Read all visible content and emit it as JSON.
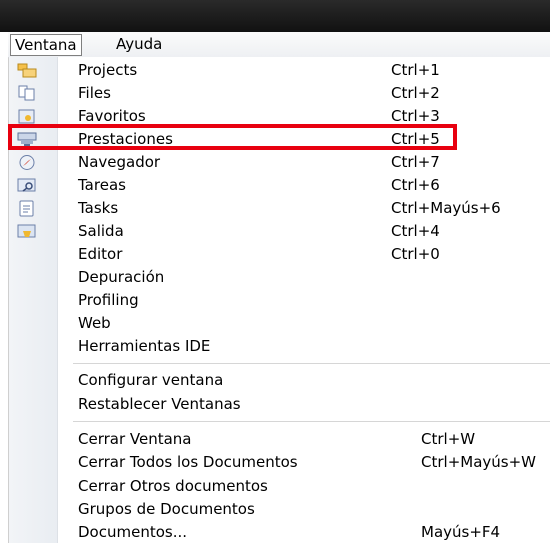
{
  "menubar": {
    "ventana": "Ventana",
    "ayuda": "Ayuda"
  },
  "menu": {
    "items": [
      {
        "label": "Projects",
        "shortcut": "Ctrl+1",
        "icon": "projects-icon"
      },
      {
        "label": "Files",
        "shortcut": "Ctrl+2",
        "icon": "files-icon"
      },
      {
        "label": "Favoritos",
        "shortcut": "Ctrl+3",
        "icon": "favorites-icon"
      },
      {
        "label": "Prestaciones",
        "shortcut": "Ctrl+5",
        "icon": "services-icon"
      },
      {
        "label": "Navegador",
        "shortcut": "Ctrl+7",
        "icon": "navigator-icon"
      },
      {
        "label": "Tareas",
        "shortcut": "Ctrl+6",
        "icon": "tasks-search-icon"
      },
      {
        "label": "Tasks",
        "shortcut": "Ctrl+Mayús+6",
        "icon": "tasks-list-icon"
      },
      {
        "label": "Salida",
        "shortcut": "Ctrl+4",
        "icon": "output-icon"
      },
      {
        "label": "Editor",
        "shortcut": "Ctrl+0"
      },
      {
        "label": "Depuración",
        "shortcut": ""
      },
      {
        "label": "Profiling",
        "shortcut": ""
      },
      {
        "label": "Web",
        "shortcut": ""
      },
      {
        "label": "Herramientas IDE",
        "shortcut": ""
      },
      {
        "label": "Configurar ventana",
        "shortcut": ""
      },
      {
        "label": "Restablecer Ventanas",
        "shortcut": ""
      },
      {
        "label": "Cerrar Ventana",
        "shortcut": "Ctrl+W"
      },
      {
        "label": "Cerrar Todos los Documentos",
        "shortcut": "Ctrl+Mayús+W"
      },
      {
        "label": "Cerrar Otros documentos",
        "shortcut": ""
      },
      {
        "label": "Grupos de Documentos",
        "shortcut": ""
      },
      {
        "label": "Documentos...",
        "shortcut": "Mayús+F4"
      }
    ]
  },
  "colors": {
    "highlight": "#e8000f",
    "titlebar": "#1a1a1a"
  }
}
